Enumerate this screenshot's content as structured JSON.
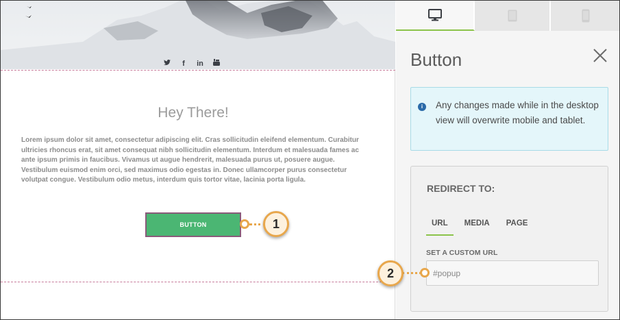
{
  "canvas": {
    "social_icons": [
      "twitter-icon",
      "facebook-icon",
      "linkedin-icon",
      "youtube-icon"
    ],
    "social_glyphs": {
      "twitter": "♦",
      "facebook": "f",
      "linkedin": "in",
      "youtube": "▶"
    },
    "heading": "Hey There!",
    "body_text": "Lorem ipsum dolor sit amet, consectetur adipiscing elit. Cras sollicitudin eleifend elementum. Curabitur ultricies rhoncus erat, sit amet consequat nibh sollicitudin elementum. Interdum et malesuada fames ac ante ipsum primis in faucibus. Vivamus ut augue hendrerit, malesuada purus ut, posuere augue. Vestibulum euismod enim orci, sed maximus odio egestas in. Donec ullamcorper purus consectetur volutpat congue. Vestibulum odio metus, interdum quis tortor vitae, lacinia porta ligula.",
    "button_label": "BUTTON",
    "button_color": "#4bb673"
  },
  "callouts": [
    {
      "label": "1"
    },
    {
      "label": "2"
    }
  ],
  "panel": {
    "device_tabs": [
      {
        "name": "desktop",
        "icon": "desktop-icon",
        "active": true
      },
      {
        "name": "tablet",
        "icon": "tablet-icon",
        "active": false
      },
      {
        "name": "mobile",
        "icon": "mobile-icon",
        "active": false
      }
    ],
    "title": "Button",
    "info_text": "Any changes made while in the desktop view will overwrite mobile and tablet.",
    "info_icon_glyph": "i",
    "redirect": {
      "title": "REDIRECT TO:",
      "tabs": [
        {
          "label": "URL",
          "active": true
        },
        {
          "label": "MEDIA",
          "active": false
        },
        {
          "label": "PAGE",
          "active": false
        }
      ],
      "url_label": "SET A CUSTOM URL",
      "url_value": "#popup"
    }
  },
  "colors": {
    "accent_green": "#8bc34a",
    "callout_orange": "#e8a74c",
    "info_bg": "#e4f6fa"
  }
}
